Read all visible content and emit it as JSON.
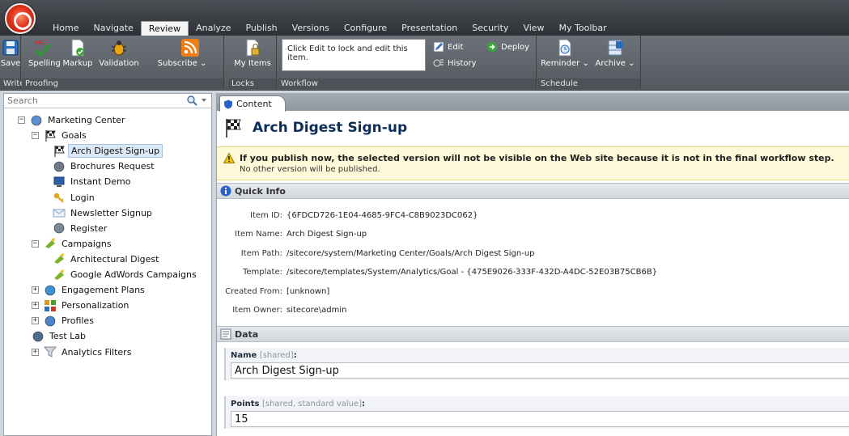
{
  "menu": {
    "tabs": [
      "Home",
      "Navigate",
      "Review",
      "Analyze",
      "Publish",
      "Versions",
      "Configure",
      "Presentation",
      "Security",
      "View",
      "My Toolbar"
    ],
    "active_tab": "Review"
  },
  "ribbon": {
    "write": {
      "label": "Write",
      "save": "Save"
    },
    "proofing": {
      "label": "Proofing",
      "spelling": "Spelling",
      "markup": "Markup",
      "validation": "Validation",
      "subscribe": "Subscribe"
    },
    "locks": {
      "label": "Locks",
      "my_items_line1": "My Items",
      "my_items_line2": ""
    },
    "workflow": {
      "label": "Workflow",
      "message": "Click Edit to lock and edit this item.",
      "edit": "Edit",
      "deploy": "Deploy",
      "history": "History"
    },
    "schedule": {
      "label": "Schedule",
      "reminder": "Reminder",
      "archive": "Archive"
    }
  },
  "search": {
    "placeholder": "Search"
  },
  "tree": [
    {
      "label": "Marketing Center",
      "icon": "marketing-center-icon",
      "expander": "minus"
    },
    {
      "label": "Goals",
      "icon": "goals-flag-icon",
      "expander": "minus"
    },
    {
      "label": "Arch Digest Sign-up",
      "icon": "goal-flag-icon",
      "expander": "",
      "selected": true
    },
    {
      "label": "Brochures Request",
      "icon": "goal-request-icon",
      "expander": ""
    },
    {
      "label": "Instant Demo",
      "icon": "monitor-icon",
      "expander": ""
    },
    {
      "label": "Login",
      "icon": "key-icon",
      "expander": ""
    },
    {
      "label": "Newsletter Signup",
      "icon": "mail-icon",
      "expander": ""
    },
    {
      "label": "Register",
      "icon": "register-icon",
      "expander": ""
    },
    {
      "label": "Campaigns",
      "icon": "campaign-icon",
      "expander": "minus"
    },
    {
      "label": "Architectural Digest",
      "icon": "campaign-icon",
      "expander": ""
    },
    {
      "label": "Google AdWords Campaigns",
      "icon": "campaign-icon",
      "expander": ""
    },
    {
      "label": "Engagement Plans",
      "icon": "engagement-icon",
      "expander": "plus"
    },
    {
      "label": "Personalization",
      "icon": "personalization-icon",
      "expander": "plus"
    },
    {
      "label": "Profiles",
      "icon": "profiles-icon",
      "expander": "plus"
    },
    {
      "label": "Test Lab",
      "icon": "testlab-icon",
      "expander": ""
    },
    {
      "label": "Analytics Filters",
      "icon": "filter-icon",
      "expander": "plus"
    }
  ],
  "content": {
    "tab": "Content",
    "title": "Arch Digest Sign-up",
    "warning": {
      "line1": "If you publish now, the selected version will not be visible on the Web site because it is not in the final workflow step.",
      "line2": "No other version will be published."
    },
    "quick_info": {
      "heading": "Quick Info",
      "rows": [
        {
          "key": "Item ID:",
          "value": "{6FDCD726-1E04-4685-9FC4-C8B9023DC062}"
        },
        {
          "key": "Item Name:",
          "value": "Arch Digest Sign-up"
        },
        {
          "key": "Item Path:",
          "value": "/sitecore/system/Marketing Center/Goals/Arch Digest Sign-up"
        },
        {
          "key": "Template:",
          "value": "/sitecore/templates/System/Analytics/Goal - {475E9026-333F-432D-A4DC-52E03B75CB6B}"
        },
        {
          "key": "Created From:",
          "value": "[unknown]"
        },
        {
          "key": "Item Owner:",
          "value": "sitecore\\admin"
        }
      ]
    },
    "data": {
      "heading": "Data",
      "name_field": {
        "label": "Name",
        "meta": "[shared]",
        "colon": ":",
        "value": "Arch Digest Sign-up"
      },
      "points_field": {
        "label": "Points",
        "meta": "[shared, standard value]",
        "colon": ":",
        "value": "15"
      }
    }
  }
}
